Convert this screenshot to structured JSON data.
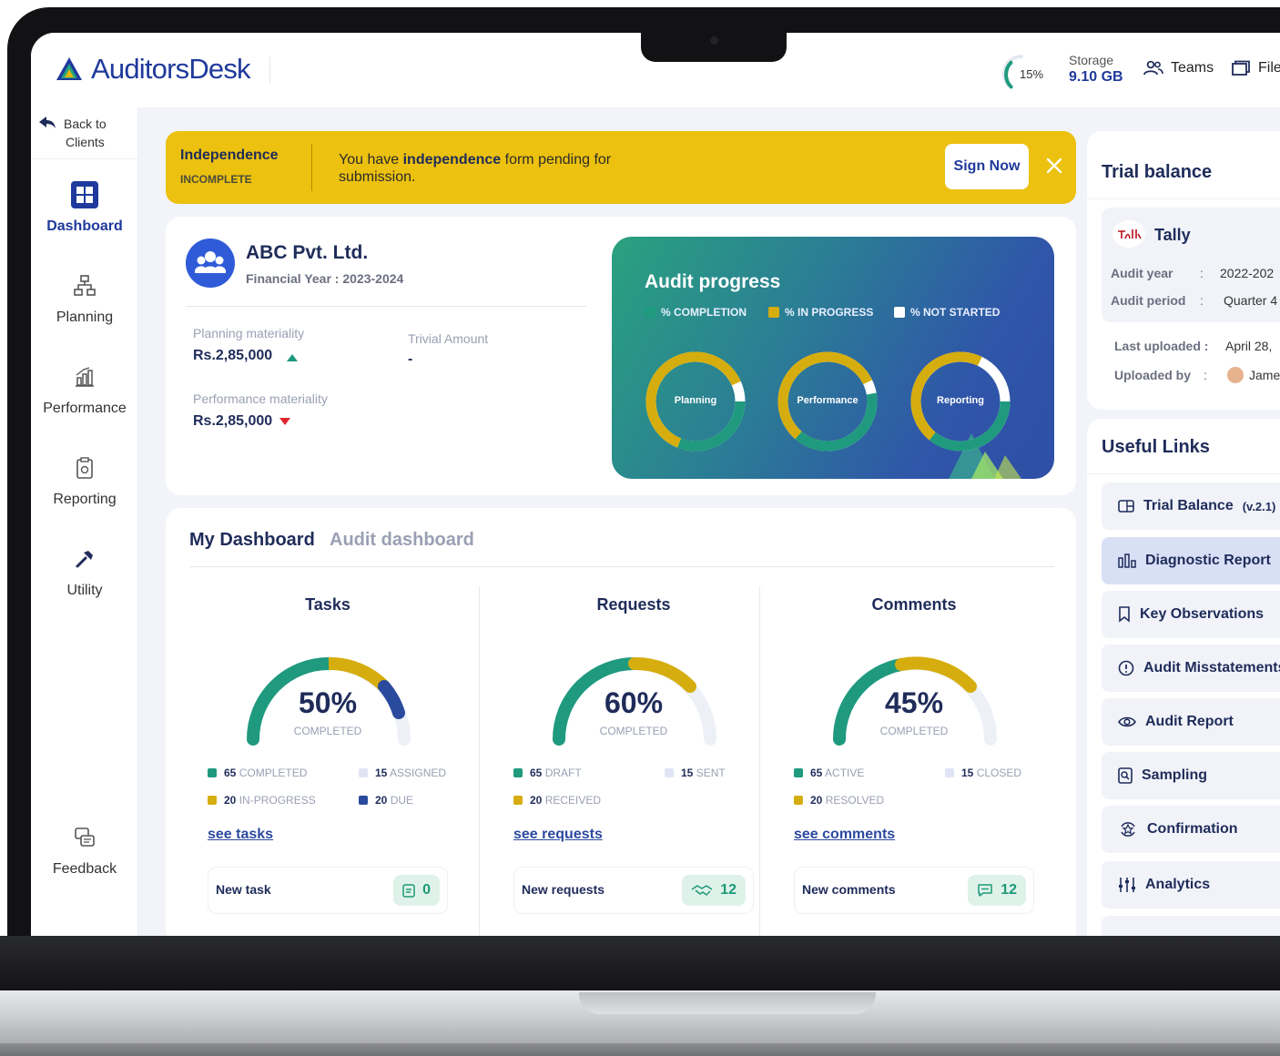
{
  "app": {
    "name": "AuditorsDesk"
  },
  "header": {
    "storage_percent": "15%",
    "storage_fraction": 0.15,
    "storage_label": "Storage",
    "storage_value": "9.10 GB",
    "links": [
      {
        "label": "Teams",
        "icon": "team-icon"
      },
      {
        "label": "File",
        "icon": "folder-icon"
      }
    ]
  },
  "sidebar": {
    "back_line1": "Back to",
    "back_line2": "Clients",
    "items": [
      {
        "label": "Dashboard",
        "icon": "dashboard-icon",
        "active": true
      },
      {
        "label": "Planning",
        "icon": "sitemap-icon"
      },
      {
        "label": "Performance",
        "icon": "chart-icon"
      },
      {
        "label": "Reporting",
        "icon": "clipboard-icon"
      },
      {
        "label": "Utility",
        "icon": "hammer-icon"
      },
      {
        "label": "Feedback",
        "icon": "feedback-icon"
      }
    ]
  },
  "banner": {
    "title": "Independence",
    "status": "INCOMPLETE",
    "message_pre": "You have ",
    "message_bold": "independence",
    "message_post": " form pending for submission.",
    "button": "Sign Now"
  },
  "client": {
    "name": "ABC Pvt. Ltd.",
    "financial_year": "Financial Year : 2023-2024",
    "planning_label": "Planning materiality",
    "planning_value": "Rs.2,85,000",
    "trivial_label": "Trivial Amount",
    "trivial_value": "-",
    "performance_label": "Performance materiality",
    "performance_value": "Rs.2,85,000"
  },
  "audit_progress": {
    "title": "Audit progress",
    "legend": [
      "% COMPLETION",
      "% IN PROGRESS",
      "% NOT STARTED"
    ],
    "rings": [
      {
        "label": "Planning"
      },
      {
        "label": "Performance"
      },
      {
        "label": "Reporting"
      }
    ]
  },
  "dashboard": {
    "tabs": [
      "My Dashboard",
      "Audit dashboard"
    ],
    "widgets": [
      {
        "title": "Tasks",
        "percent": "50%",
        "fraction": 0.5,
        "sub": "COMPLETED",
        "legend": [
          {
            "num": "65",
            "text": "COMPLETED"
          },
          {
            "num": "15",
            "text": "ASSIGNED"
          },
          {
            "num": "20",
            "text": "IN-PROGRESS"
          },
          {
            "num": "20",
            "text": "DUE"
          }
        ],
        "link": "see tasks",
        "new_label": "New task",
        "new_count": "0"
      },
      {
        "title": "Requests",
        "percent": "60%",
        "fraction": 0.6,
        "sub": "COMPLETED",
        "legend": [
          {
            "num": "65",
            "text": "DRAFT"
          },
          {
            "num": "15",
            "text": "SENT"
          },
          {
            "num": "20",
            "text": "RECEIVED"
          }
        ],
        "link": "see requests",
        "new_label": "New requests",
        "new_count": "12"
      },
      {
        "title": "Comments",
        "percent": "45%",
        "fraction": 0.45,
        "sub": "COMPLETED",
        "legend": [
          {
            "num": "65",
            "text": "ACTIVE"
          },
          {
            "num": "15",
            "text": "CLOSED"
          },
          {
            "num": "20",
            "text": "RESOLVED"
          }
        ],
        "link": "see comments",
        "new_label": "New comments",
        "new_count": "12"
      }
    ]
  },
  "trial_balance": {
    "title": "Trial balance",
    "source": "Tally",
    "audit_year_label": "Audit year",
    "audit_year_value": "2022-202",
    "audit_period_label": "Audit period",
    "audit_period_value": "Quarter 4",
    "last_uploaded_label": "Last uploaded :",
    "last_uploaded_value": "April 28,",
    "uploaded_by_label": "Uploaded by",
    "uploaded_by_value": "Jame"
  },
  "useful_links": {
    "title": "Useful Links",
    "items": [
      {
        "label": "Trial Balance",
        "suffix": "(v.2.1)",
        "icon": "table-icon"
      },
      {
        "label": "Diagnostic Report",
        "icon": "bar-chart-icon",
        "active": true
      },
      {
        "label": "Key Observations",
        "icon": "bookmark-icon"
      },
      {
        "label": "Audit Misstatements",
        "icon": "alert-circle-icon"
      },
      {
        "label": "Audit Report",
        "icon": "eye-icon"
      },
      {
        "label": "Sampling",
        "icon": "document-search-icon"
      },
      {
        "label": "Confirmation",
        "icon": "star-cycle-icon"
      },
      {
        "label": "Analytics",
        "icon": "sliders-icon"
      }
    ]
  },
  "colors": {
    "brand": "#1f3a9c",
    "teal": "#1f9a7e",
    "gold": "#d6ad0e",
    "navy": "#2a4a9e",
    "banner": "#ecc10f"
  }
}
